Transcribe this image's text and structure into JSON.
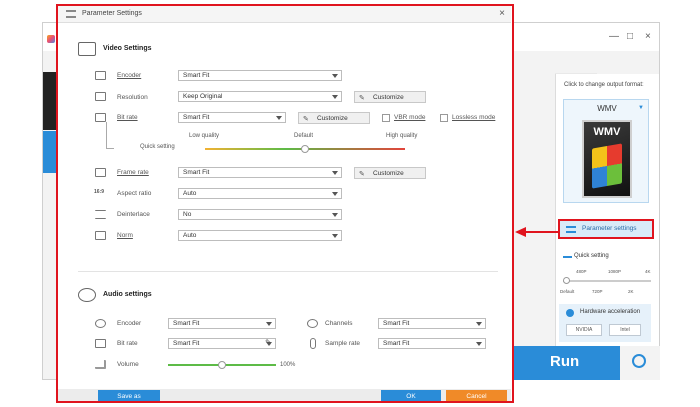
{
  "dialog": {
    "title": "Parameter Settings",
    "close": "×"
  },
  "video": {
    "section_title": "Video Settings",
    "encoder": {
      "label": "Encoder",
      "value": "Smart Fit"
    },
    "resolution": {
      "label": "Resolution",
      "value": "Keep Original",
      "customize": "Customize"
    },
    "bitrate": {
      "label": "Bit rate",
      "value": "Smart Fit",
      "customize": "Customize",
      "vbr": "VBR mode",
      "lossless": "Lossless mode"
    },
    "quick": {
      "label": "Quick setting",
      "low": "Low quality",
      "default": "Default",
      "high": "High quality",
      "level": 0.5
    },
    "framerate": {
      "label": "Frame rate",
      "value": "Smart Fit",
      "customize": "Customize"
    },
    "aspect": {
      "label": "Aspect ratio",
      "value": "Auto",
      "icon_text": "16:9"
    },
    "deinterlace": {
      "label": "Deinterlace",
      "value": "No"
    },
    "norm": {
      "label": "Norm",
      "value": "Auto"
    }
  },
  "audio": {
    "section_title": "Audio settings",
    "encoder": {
      "label": "Encoder",
      "value": "Smart Fit"
    },
    "channels": {
      "label": "Channels",
      "value": "Smart Fit"
    },
    "bitrate": {
      "label": "Bit rate",
      "value": "Smart Fit"
    },
    "samplerate": {
      "label": "Sample rate",
      "value": "Smart Fit"
    },
    "volume": {
      "label": "Volume",
      "value": "100%",
      "level": 0.5
    }
  },
  "footer": {
    "save_as": "Save as",
    "ok": "OK",
    "cancel": "Cancel"
  },
  "app": {
    "window_controls": [
      "—",
      "□",
      "×"
    ],
    "output_caption": "Click to change output format:",
    "format_name": "WMV",
    "format_logo": "WMV",
    "param_settings": "Parameter settings",
    "quick_setting": "Quick setting",
    "ticks_top": [
      "480P",
      "1080P",
      "4K"
    ],
    "ticks_bottom": [
      "Default",
      "720P",
      "2K"
    ],
    "hw_accel": "Hardware acceleration",
    "hw_chip_nvidia": "NVIDIA",
    "hw_chip_intel": "Intel",
    "run": "Run"
  },
  "colors": {
    "accent": "#2a8cd8",
    "highlight": "#e0141e",
    "ok_button": "#2a8cd8",
    "cancel_button": "#f08a28"
  }
}
